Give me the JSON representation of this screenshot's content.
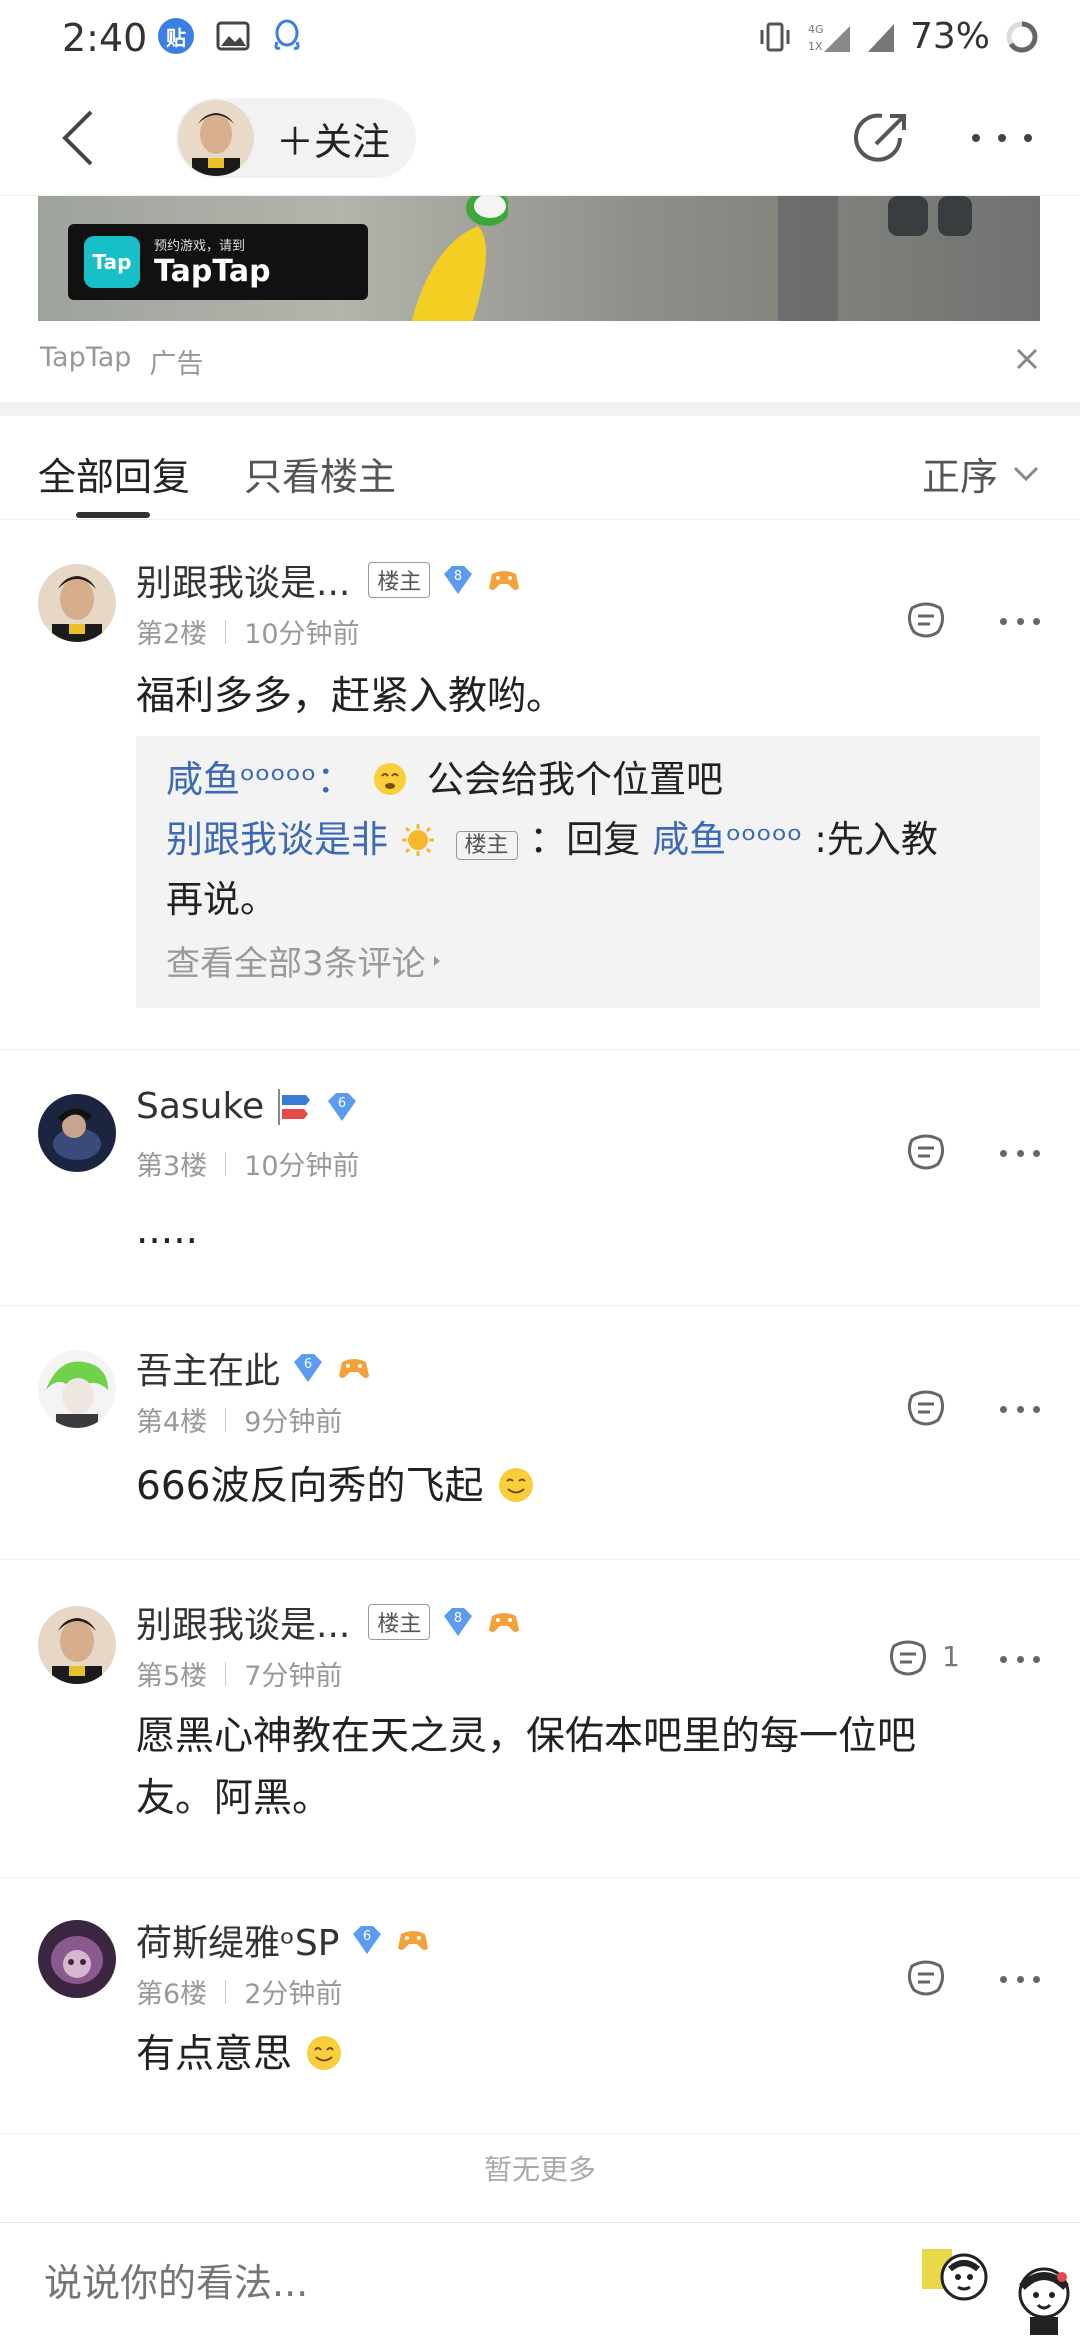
{
  "status_bar": {
    "time": "2:40",
    "badge_label": "贴",
    "battery_percent": "73%"
  },
  "nav": {
    "follow_label": "＋关注"
  },
  "ad": {
    "logo_small": "预约游戏，请到",
    "logo_text": "TapTap",
    "logo_mark": "Tap",
    "source": "TapTap",
    "label": "广告"
  },
  "tabs": {
    "all_replies": "全部回复",
    "only_op": "只看楼主",
    "sort_label": "正序"
  },
  "posts": [
    {
      "username": "别跟我谈是...",
      "op_tag": "楼主",
      "level": "8",
      "floor": "第2楼",
      "time": "10分钟前",
      "content": "福利多多，赶紧入教哟。",
      "sub_replies": {
        "line1_user": "咸鱼ᵒᵒᵒᵒᵒ：",
        "line1_text": "公会给我个位置吧",
        "line2_user": "别跟我谈是非",
        "line2_tag": "楼主",
        "line2_prefix": "：回复",
        "line2_target": "咸鱼ᵒᵒᵒᵒᵒ",
        "line2_text": ":先入教",
        "line3_text": "再说。",
        "view_all": "查看全部3条评论"
      }
    },
    {
      "username": "Sasuke",
      "level": "6",
      "floor": "第3楼",
      "time": "10分钟前",
      "content": "....."
    },
    {
      "username": "吾主在此",
      "level": "6",
      "floor": "第4楼",
      "time": "9分钟前",
      "content": "666波反向秀的飞起"
    },
    {
      "username": "别跟我谈是...",
      "op_tag": "楼主",
      "level": "8",
      "floor": "第5楼",
      "time": "7分钟前",
      "reply_count": "1",
      "content_line1": "愿黑心神教在天之灵，保佑本吧里的每一位吧",
      "content_line2": "友。阿黑。"
    },
    {
      "username": "荷斯缇雅ᵒSP",
      "level": "6",
      "floor": "第6楼",
      "time": "2分钟前",
      "content": "有点意思"
    }
  ],
  "no_more": "暂无更多",
  "bottom": {
    "placeholder": "说说你的看法..."
  },
  "colors": {
    "link_blue": "#3d6ab8",
    "level_badge": "#5b9cf0",
    "game_badge": "#f3a23b"
  }
}
